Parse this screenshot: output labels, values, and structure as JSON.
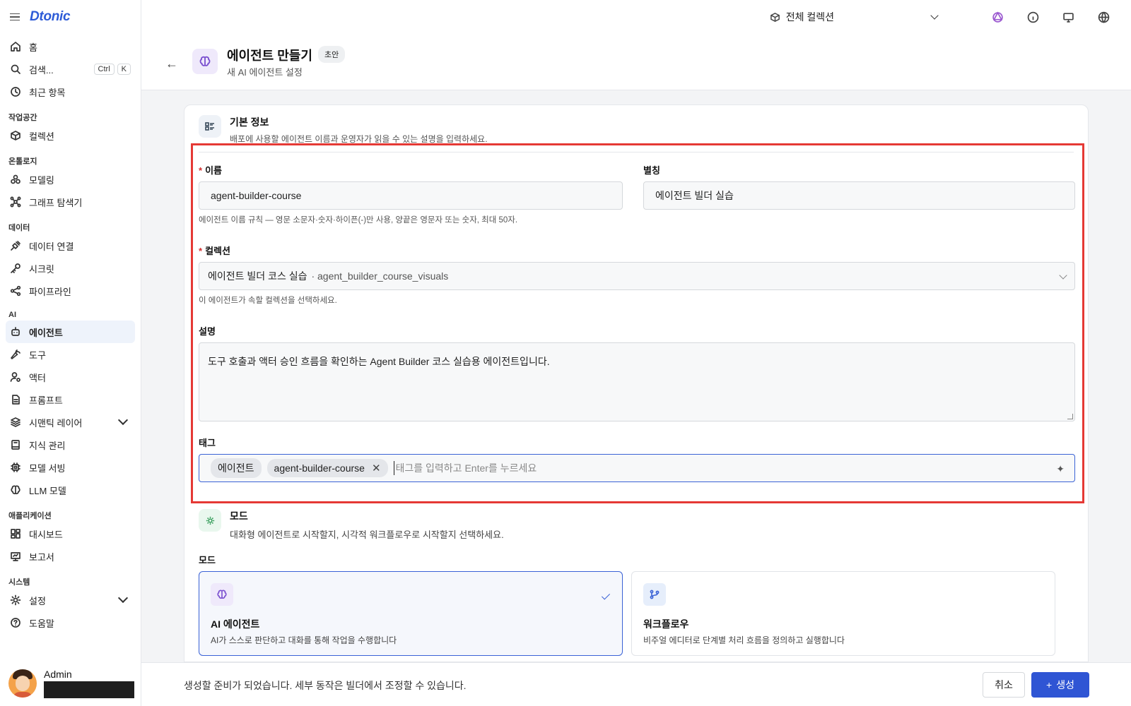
{
  "sidebar": {
    "brand": "Dtonic",
    "top_items": [
      {
        "label": "홈",
        "icon": "home-icon"
      },
      {
        "label": "검색...",
        "icon": "search-icon",
        "kbd": [
          "Ctrl",
          "K"
        ]
      },
      {
        "label": "최근 항목",
        "icon": "clock-icon"
      }
    ],
    "sections": {
      "workspace": "작업공간",
      "ontology": "온톨로지",
      "data": "데이터",
      "ai": "AI",
      "apps": "애플리케이션",
      "system": "시스템"
    },
    "items": {
      "collection": "컬렉션",
      "modeling": "모델링",
      "graph": "그래프 탐색기",
      "data_conn": "데이터 연결",
      "secret": "시크릿",
      "pipeline": "파이프라인",
      "agent": "에이전트",
      "tool": "도구",
      "actor": "액터",
      "prompt": "프롬프트",
      "semantic": "시맨틱 레이어",
      "knowledge": "지식 관리",
      "serving": "모델 서빙",
      "llm": "LLM 모델",
      "dashboard": "대시보드",
      "report": "보고서",
      "settings": "설정",
      "help": "도움말"
    },
    "user": {
      "name": "Admin"
    }
  },
  "topbar": {
    "collection_select": "전체 컬렉션"
  },
  "header": {
    "title": "에이전트 만들기",
    "badge": "초안",
    "subtitle": "새 AI 에이전트 설정"
  },
  "basic_info": {
    "title": "기본 정보",
    "desc": "배포에 사용할 에이전트 이름과 운영자가 읽을 수 있는 설명을 입력하세요.",
    "name_label": "이름",
    "name_value": "agent-builder-course",
    "name_hint": "에이전트 이름 규칙 — 영문 소문자·숫자·하이픈(-)만 사용, 양끝은 영문자 또는 숫자, 최대 50자.",
    "alias_label": "별칭",
    "alias_value": "에이전트 빌더 실습",
    "collection_label": "컬렉션",
    "collection_value": "에이전트 빌더 코스 실습",
    "collection_meta": "· agent_builder_course_visuals",
    "collection_hint": "이 에이전트가 속할 컬렉션을 선택하세요.",
    "desc_label": "설명",
    "desc_value": "도구 호출과 액터 승인 흐름을 확인하는 Agent Builder 코스 실습용 에이전트입니다.",
    "tags_label": "태그",
    "tags": [
      "에이전트",
      "agent-builder-course"
    ],
    "tag_placeholder": "태그를 입력하고 Enter를 누르세요"
  },
  "mode": {
    "title": "모드",
    "desc": "대화형 에이전트로 시작할지, 시각적 워크플로우로 시작할지 선택하세요.",
    "label": "모드",
    "options": [
      {
        "title": "AI 에이전트",
        "desc": "AI가 스스로 판단하고 대화를 통해 작업을 수행합니다",
        "selected": true
      },
      {
        "title": "워크플로우",
        "desc": "비주얼 에디터로 단계별 처리 흐름을 정의하고 실행합니다",
        "selected": false
      }
    ]
  },
  "footer": {
    "message": "생성할 준비가 되었습니다. 세부 동작은 빌더에서 조정할 수 있습니다.",
    "cancel": "취소",
    "create": "생성"
  },
  "colors": {
    "accent": "#2f55d4",
    "highlight": "#e53935",
    "required": "#d32f2f"
  }
}
